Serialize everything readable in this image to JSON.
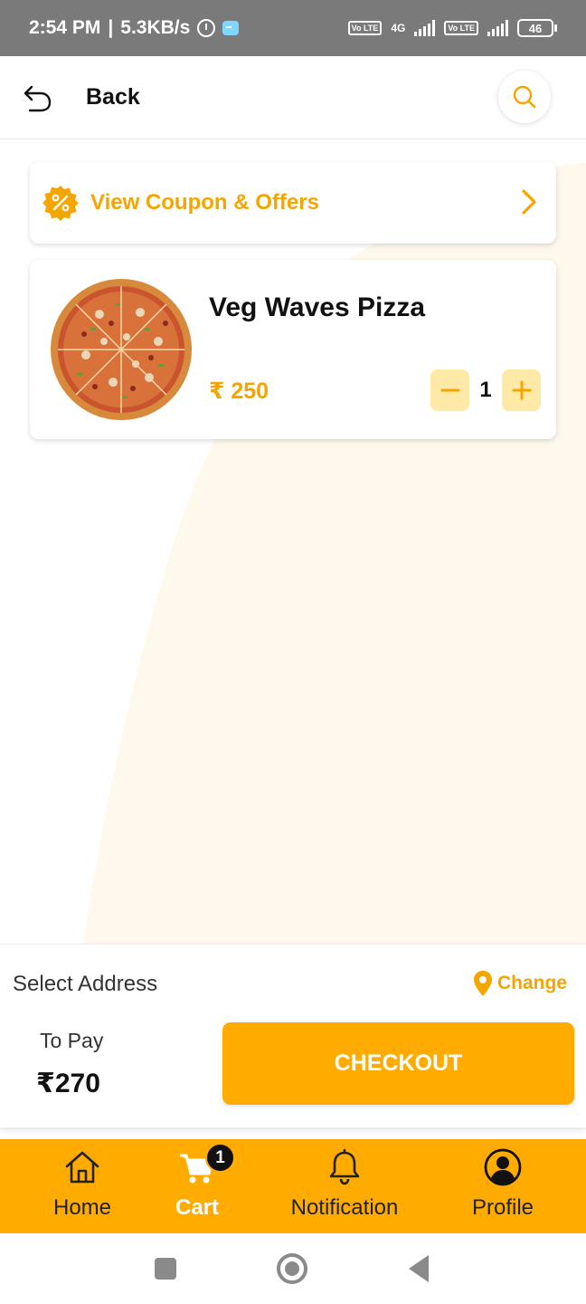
{
  "status_bar": {
    "time": "2:54 PM",
    "network_speed": "5.3KB/s",
    "separator": "|",
    "sim1": "Vo LTE",
    "network_type": "4G",
    "sim2": "Vo LTE",
    "battery": "46",
    "icons": [
      "alarm-icon",
      "game-icon",
      "signal-icon",
      "battery-icon"
    ]
  },
  "header": {
    "back_label": "Back",
    "back_icon": "undo-arrow-icon",
    "search_icon": "search-icon"
  },
  "coupon": {
    "label": "View Coupon & Offers",
    "badge_icon": "discount-badge-icon",
    "chevron_icon": "chevron-right-icon"
  },
  "cart_items": [
    {
      "name": "Veg Waves Pizza",
      "price": "₹ 250",
      "quantity": "1",
      "image": "pizza-image"
    }
  ],
  "checkout": {
    "select_address_label": "Select Address",
    "change_label": "Change",
    "to_pay_label": "To Pay",
    "total": "₹270",
    "checkout_label": "CHECKOUT"
  },
  "bottom_nav": {
    "home": "Home",
    "cart": "Cart",
    "cart_badge": "1",
    "notification": "Notification",
    "profile": "Profile",
    "active": "cart"
  },
  "colors": {
    "accent": "#ffab00",
    "accent_text": "#f5a500",
    "stepper_bg": "#ffe9a6",
    "background_shape": "#fff8ec"
  }
}
